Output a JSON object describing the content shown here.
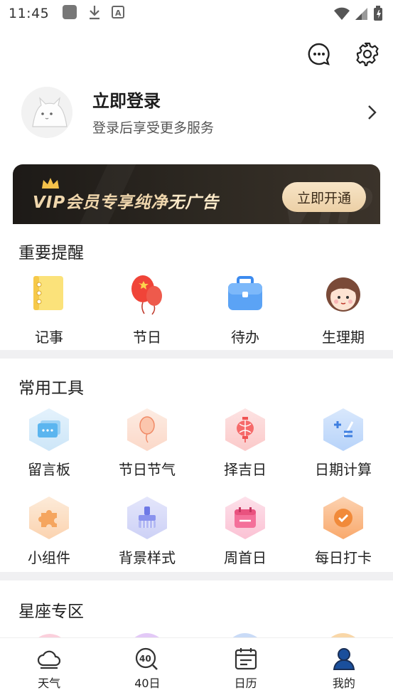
{
  "status_bar": {
    "time": "11:45"
  },
  "profile": {
    "title": "立即登录",
    "subtitle": "登录后享受更多服务"
  },
  "vip": {
    "text_main": "VIP会员专享纯净",
    "text_accent": "无广告",
    "button": "立即开通"
  },
  "reminders": {
    "title": "重要提醒",
    "items": [
      {
        "label": "记事",
        "icon": "notebook-icon"
      },
      {
        "label": "节日",
        "icon": "balloon-icon"
      },
      {
        "label": "待办",
        "icon": "briefcase-icon"
      },
      {
        "label": "生理期",
        "icon": "girl-face-icon"
      }
    ]
  },
  "tools": {
    "title": "常用工具",
    "items": [
      {
        "label": "留言板",
        "icon": "message-board-icon"
      },
      {
        "label": "节日节气",
        "icon": "balloon-icon"
      },
      {
        "label": "择吉日",
        "icon": "lantern-icon"
      },
      {
        "label": "日期计算",
        "icon": "calculator-icon"
      },
      {
        "label": "小组件",
        "icon": "puzzle-icon"
      },
      {
        "label": "背景样式",
        "icon": "brush-icon"
      },
      {
        "label": "周首日",
        "icon": "calendar-icon"
      },
      {
        "label": "每日打卡",
        "icon": "checkin-icon"
      }
    ]
  },
  "zodiac": {
    "title": "星座专区"
  },
  "bottom_nav": [
    {
      "label": "天气",
      "icon": "weather-cloud-icon"
    },
    {
      "label": "40日",
      "icon": "forty-day-search-icon"
    },
    {
      "label": "日历",
      "icon": "calendar-icon"
    },
    {
      "label": "我的",
      "icon": "user-icon",
      "active": true
    }
  ],
  "colors": {
    "accent": "#1a4f9c",
    "vip_gold": "#f0d7ad",
    "divider": "#f0f0f2"
  }
}
